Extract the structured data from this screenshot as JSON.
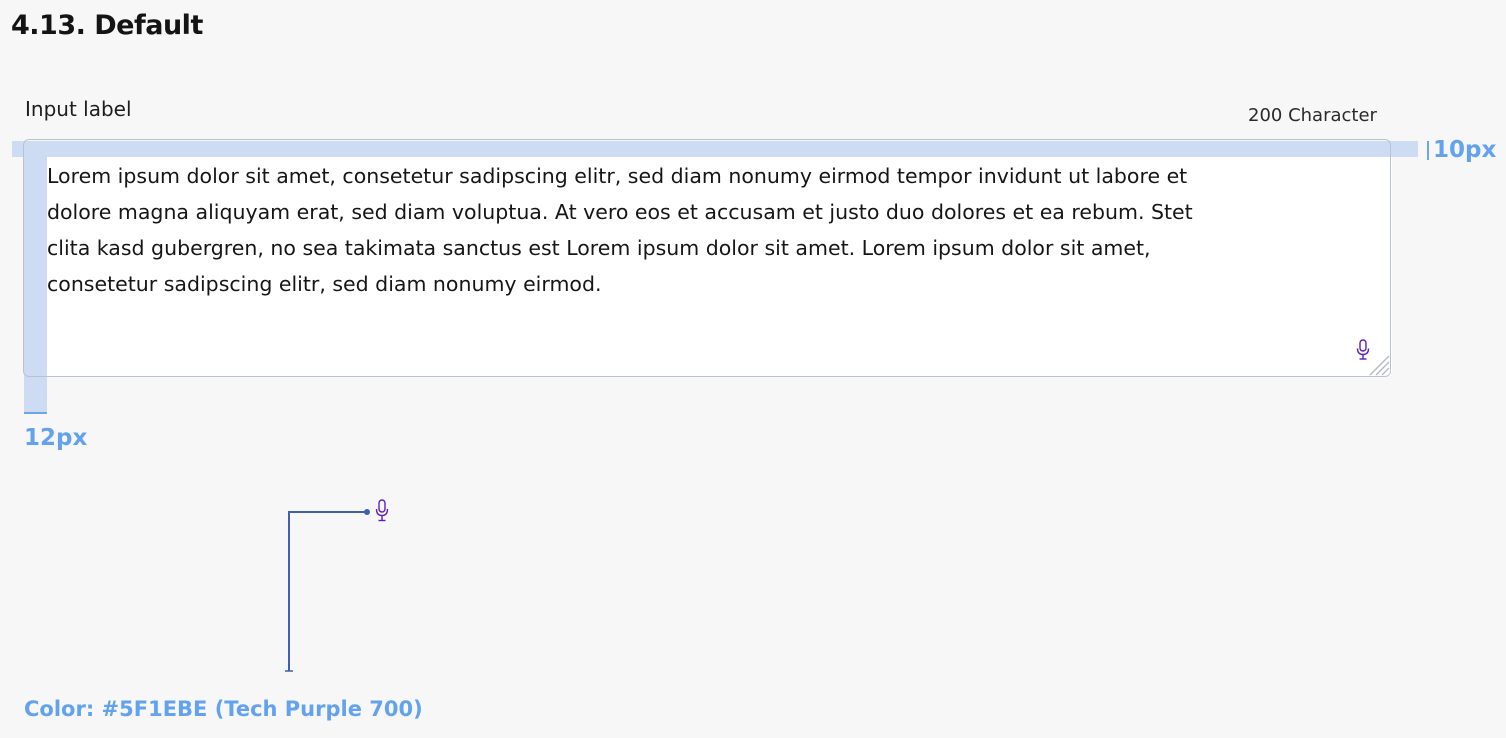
{
  "section": {
    "title": "4.13. Default"
  },
  "field": {
    "label": "Input label",
    "character_count": "200 Character",
    "value": "Lorem ipsum dolor sit amet, consetetur sadipscing elitr, sed diam nonumy eirmod tempor invidunt ut labore et\ndolore magna aliquyam erat, sed diam voluptua. At vero eos et accusam et justo duo dolores et ea rebum. Stet\nclita kasd gubergren, no sea takimata sanctus est Lorem ipsum dolor sit amet. Lorem ipsum dolor sit amet,\nconsetetur sadipscing elitr, sed diam nonumy eirmod.",
    "icon": "microphone-icon"
  },
  "annotations": {
    "top_padding": "10px",
    "left_padding": "12px",
    "icon_color_note": "Color: #5F1EBE (Tech Purple 700)"
  },
  "colors": {
    "icon_purple": "#5F1EBE",
    "annotation_blue": "#62A2EE",
    "highlight": "#CDDCF3",
    "leader_line": "#3F5FAF",
    "field_border": "#B9C3CF"
  }
}
